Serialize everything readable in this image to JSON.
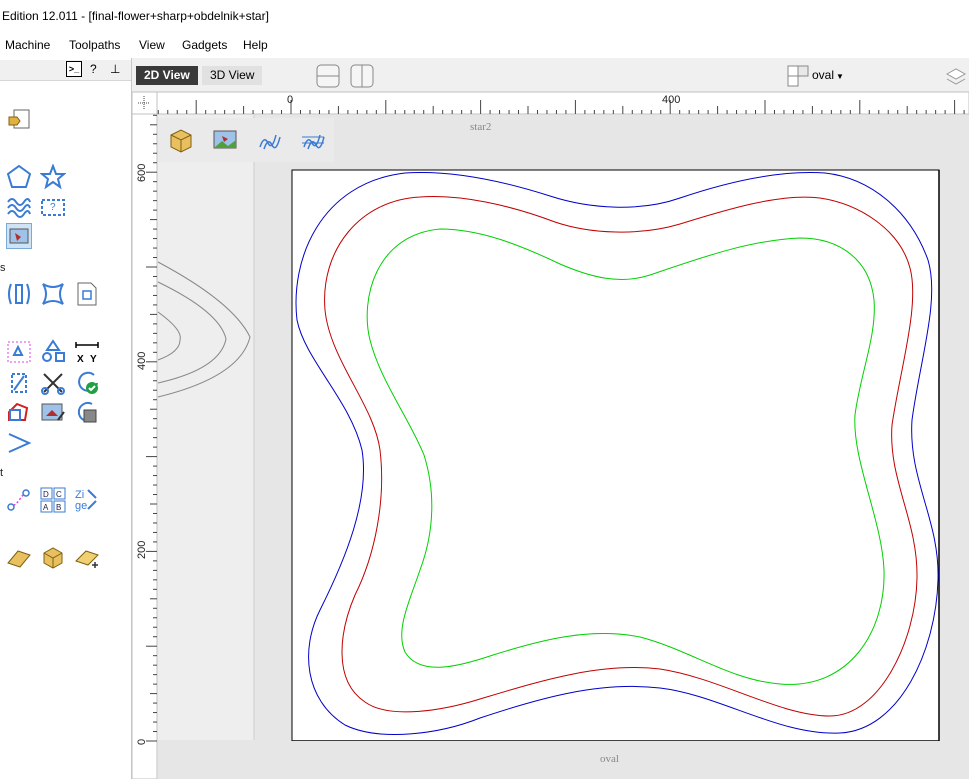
{
  "window": {
    "title": "Edition 12.011 - [final-flower+sharp+obdelnik+star]"
  },
  "menu": [
    {
      "label": "Machine"
    },
    {
      "label": "Toolpaths"
    },
    {
      "label": "View"
    },
    {
      "label": "Gadgets"
    },
    {
      "label": "Help"
    }
  ],
  "panel_header": {
    "cmd_label": ">_",
    "help_label": "?",
    "pin_label": "⊥"
  },
  "view_tabs": {
    "tab_2d": "2D View",
    "tab_3d": "3D View"
  },
  "layer_dropdown": {
    "selected": "oval"
  },
  "rulers": {
    "x_labels": [
      "0",
      "400"
    ],
    "y_labels": [
      "600",
      "400",
      "200",
      "0"
    ]
  },
  "canvas": {
    "top_layer_label": "star2",
    "bottom_layer_label": "oval"
  },
  "side_labels": [
    "s",
    "t"
  ],
  "colors": {
    "blue": "#0000c8",
    "red": "#c00000",
    "green": "#00d000",
    "accent": "#3a7bd5"
  }
}
